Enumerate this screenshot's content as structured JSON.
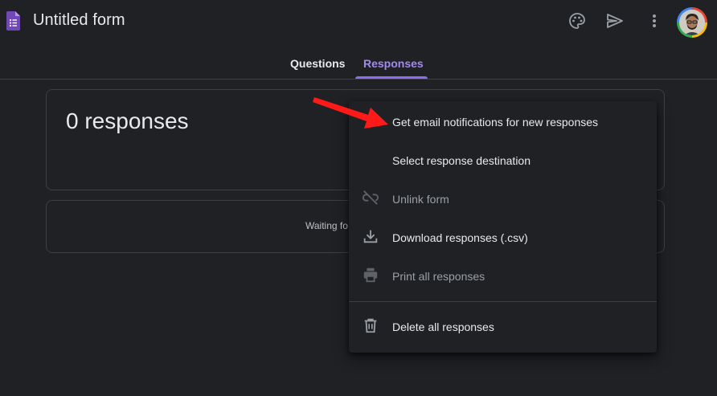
{
  "header": {
    "title": "Untitled form",
    "icons": [
      "forms-logo-icon",
      "palette-icon",
      "send-icon",
      "more-vert-icon",
      "avatar"
    ]
  },
  "tabs": [
    {
      "label": "Questions",
      "active": false
    },
    {
      "label": "Responses",
      "active": true
    }
  ],
  "summary": {
    "responses_count": "0 responses",
    "waiting_text": "Waiting fo"
  },
  "menu": {
    "items": [
      {
        "label": "Get email notifications for new responses",
        "icon": "none",
        "disabled": false
      },
      {
        "label": "Select response destination",
        "icon": "none",
        "disabled": false
      },
      {
        "label": "Unlink form",
        "icon": "unlink-icon",
        "disabled": true
      },
      {
        "label": "Download responses (.csv)",
        "icon": "download-icon",
        "disabled": false
      },
      {
        "label": "Print all responses",
        "icon": "print-icon",
        "disabled": true
      },
      {
        "label": "Delete all responses",
        "icon": "trash-icon",
        "disabled": false
      }
    ]
  },
  "colors": {
    "background": "#202124",
    "accent": "#8e6cef",
    "forms_purple": "#7248b9",
    "annotation_arrow": "#ff1a1a"
  }
}
